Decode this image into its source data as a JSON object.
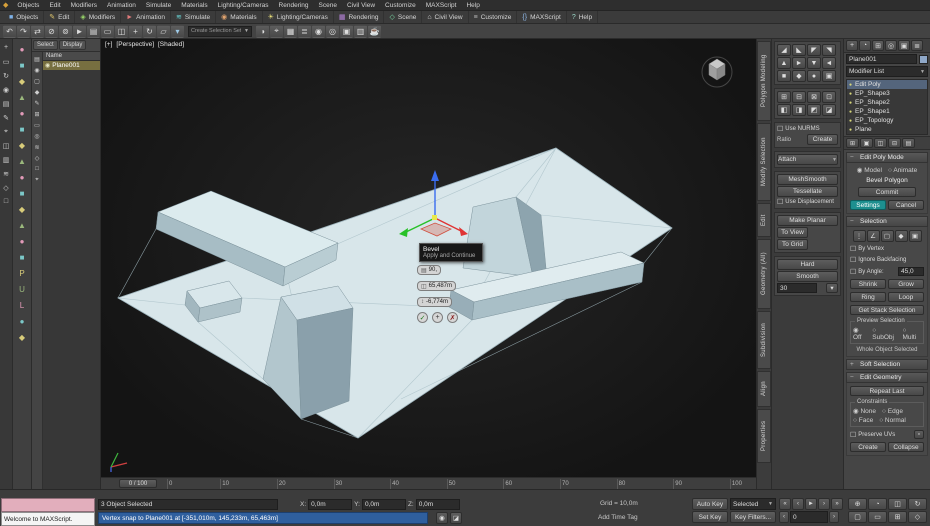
{
  "colors": {
    "accent_teal": "#1d8f8f",
    "selection_blue": "#54657c",
    "mesh_top": "#d8e6ea",
    "viewport_bg": "#141414"
  },
  "menu": {
    "logo_icon": "◆",
    "items": [
      "Objects",
      "Edit",
      "Modifiers",
      "Animation",
      "Simulate",
      "Materials",
      "Lighting/Cameras",
      "Rendering",
      "Scene",
      "Civil View",
      "Customize",
      "MAXScript",
      "Help"
    ]
  },
  "ribbon": {
    "groups": [
      {
        "g": "■",
        "label": "Objects"
      },
      {
        "g": "✎",
        "label": "Edit"
      },
      {
        "g": "◈",
        "label": "Modifiers"
      },
      {
        "g": "►",
        "label": "Animation"
      },
      {
        "g": "≋",
        "label": "Simulate"
      },
      {
        "g": "◉",
        "label": "Materials"
      },
      {
        "g": "☀",
        "label": "Lighting/Cameras"
      },
      {
        "g": "▦",
        "label": "Rendering"
      },
      {
        "g": "◇",
        "label": "Scene"
      },
      {
        "g": "⌂",
        "label": "Civil View"
      },
      {
        "g": "≡",
        "label": "Customize"
      },
      {
        "g": "{}",
        "label": "MAXScript"
      },
      {
        "g": "?",
        "label": "Help"
      }
    ]
  },
  "main_toolbar": {
    "icons_left": [
      "↶",
      "↷",
      "⇄",
      "⊘",
      "⊚",
      "►",
      "▤",
      "▭",
      "◫",
      "+",
      "↻",
      "▱",
      "▾"
    ],
    "named_sets_placeholder": "Create Selection Set",
    "icons_right": [
      "◑",
      "⌖",
      "▦",
      "≣",
      "◉",
      "◎",
      "▣",
      "▥",
      "☕"
    ]
  },
  "left_toolbar": {
    "icons": [
      "+",
      "▭",
      "↻",
      "◉",
      "▤",
      "✎",
      "⌖",
      "◫",
      "▥",
      "≋",
      "◇",
      "□"
    ]
  },
  "left_strip": {
    "icons": [
      "●",
      "■",
      "◆",
      "▲",
      "●",
      "■",
      "◆",
      "▲",
      "●",
      "■",
      "◆",
      "▲",
      "●",
      "■",
      "P",
      "U",
      "L",
      "●",
      "◆"
    ]
  },
  "explorer": {
    "tabs": [
      "Select",
      "Display"
    ],
    "name_header": "Name",
    "toolbar_icons": [
      "▤",
      "◉",
      "▢",
      "◆",
      "✎",
      "⊞",
      "▭",
      "◎",
      "≋",
      "◇",
      "□",
      "⌖"
    ],
    "items": [
      {
        "icon": "◉",
        "label": "Plane001"
      }
    ]
  },
  "viewport": {
    "labels": {
      "plus": "[+]",
      "view": "[Perspective]",
      "shading": "[Shaded]"
    },
    "tooltip": {
      "title": "Bevel",
      "subtitle": "Apply and Continue"
    },
    "caddy": {
      "fields": [
        {
          "icon": "▤",
          "value": "90,"
        },
        {
          "icon": "◫",
          "value": "65,487m"
        },
        {
          "icon": "↕",
          "value": "-6,774m"
        }
      ],
      "buttons": [
        {
          "g": "✓"
        },
        {
          "g": "+"
        },
        {
          "g": "✗"
        }
      ]
    }
  },
  "timeline": {
    "slider": "0 / 100",
    "ticks": [
      "0",
      "10",
      "20",
      "30",
      "40",
      "50",
      "60",
      "70",
      "80",
      "90",
      "100"
    ]
  },
  "ribbon_tabs": {
    "items": [
      "Polygon Modeling",
      "Modify Selection",
      "Edit",
      "Geometry (All)",
      "Subdivision",
      "Align",
      "Properties"
    ]
  },
  "tool_panels": {
    "grid1_icons": [
      "◢",
      "◣",
      "◤",
      "◥",
      "▲",
      "►",
      "▼",
      "◄",
      "■",
      "◆",
      "●",
      "▣"
    ],
    "grid2_icons": [
      "⊞",
      "⊟",
      "⊠",
      "⊡",
      "◧",
      "◨",
      "◩",
      "◪"
    ],
    "use_nurms": "Use NURMS",
    "ratio_label": "Ratio",
    "create": "Create",
    "attach": "Attach",
    "meshsmooth": "MeshSmooth",
    "tessellate": "Tessellate",
    "use_displacement": "Use Displacement",
    "make_planar": "Make Planar",
    "to_view": "To View",
    "to_grid": "To Grid",
    "hard": "Hard",
    "smooth": "Smooth",
    "autosmooth": "30"
  },
  "command_panel": {
    "tabs": [
      "+",
      "◔",
      "⊞",
      "◎",
      "▣",
      "≣"
    ],
    "object_name": "Plane001",
    "modifier_list": "Modifier List",
    "stack": [
      {
        "g": "●",
        "label": "Edit Poly"
      },
      {
        "g": "●",
        "label": "EP_Shape3"
      },
      {
        "g": "●",
        "label": "EP_Shape2"
      },
      {
        "g": "●",
        "label": "EP_Shape1"
      },
      {
        "g": "●",
        "label": "EP_Topology"
      },
      {
        "g": "●",
        "label": "Plane"
      }
    ],
    "stack_tools": [
      "⊞",
      "▣",
      "◫",
      "⊟",
      "▤"
    ],
    "epm": {
      "title": "Edit Poly Mode",
      "model": "Model",
      "animate": "Animate",
      "operation": "Bevel Polygon",
      "commit": "Commit",
      "settings": "Settings",
      "cancel": "Cancel"
    },
    "selection": {
      "title": "Selection",
      "subobj_icons": [
        "⋮",
        "∠",
        "▢",
        "◆",
        "▣"
      ],
      "by_vertex": "By Vertex",
      "ignore_backfacing": "Ignore Backfacing",
      "by_angle": "By Angle:",
      "angle": "45,0",
      "shrink": "Shrink",
      "grow": "Grow",
      "ring": "Ring",
      "loop": "Loop",
      "get_stack": "Get Stack Selection",
      "preview_title": "Preview Selection",
      "off": "Off",
      "subobj": "SubObj",
      "multi": "Multi",
      "status": "Whole Object Selected"
    },
    "soft_selection": {
      "title": "Soft Selection"
    },
    "edit_geometry": {
      "title": "Edit Geometry",
      "repeat_last": "Repeat Last",
      "constraints": "Constraints",
      "none": "None",
      "edge": "Edge",
      "face": "Face",
      "normal": "Normal",
      "preserve_uvs": "Preserve UVs",
      "create": "Create",
      "collapse": "Collapse"
    }
  },
  "status_bar": {
    "listener_text": "Welcome to MAXScript.",
    "selection_info": "3 Object Selected",
    "prompt": "Vertex snap to Plane001 at [-351,010m, 145,233m, 65,463m]",
    "coord_x_label": "X:",
    "coord_x": "0,0m",
    "coord_y_label": "Y:",
    "coord_y": "0,0m",
    "coord_z_label": "Z:",
    "coord_z": "0,0m",
    "grid_label": "Grid = 10,0m",
    "add_time_tag": "Add Time Tag",
    "auto_key": "Auto Key",
    "selected": "Selected",
    "set_key": "Set Key",
    "key_filters": "Key Filters...",
    "frame": "0",
    "transport": [
      "«",
      "‹",
      "►",
      "›",
      "»"
    ],
    "nav_icons": [
      "⊕",
      "◔",
      "◫",
      "↻",
      "▢",
      "▭",
      "⊞",
      "◇"
    ]
  }
}
